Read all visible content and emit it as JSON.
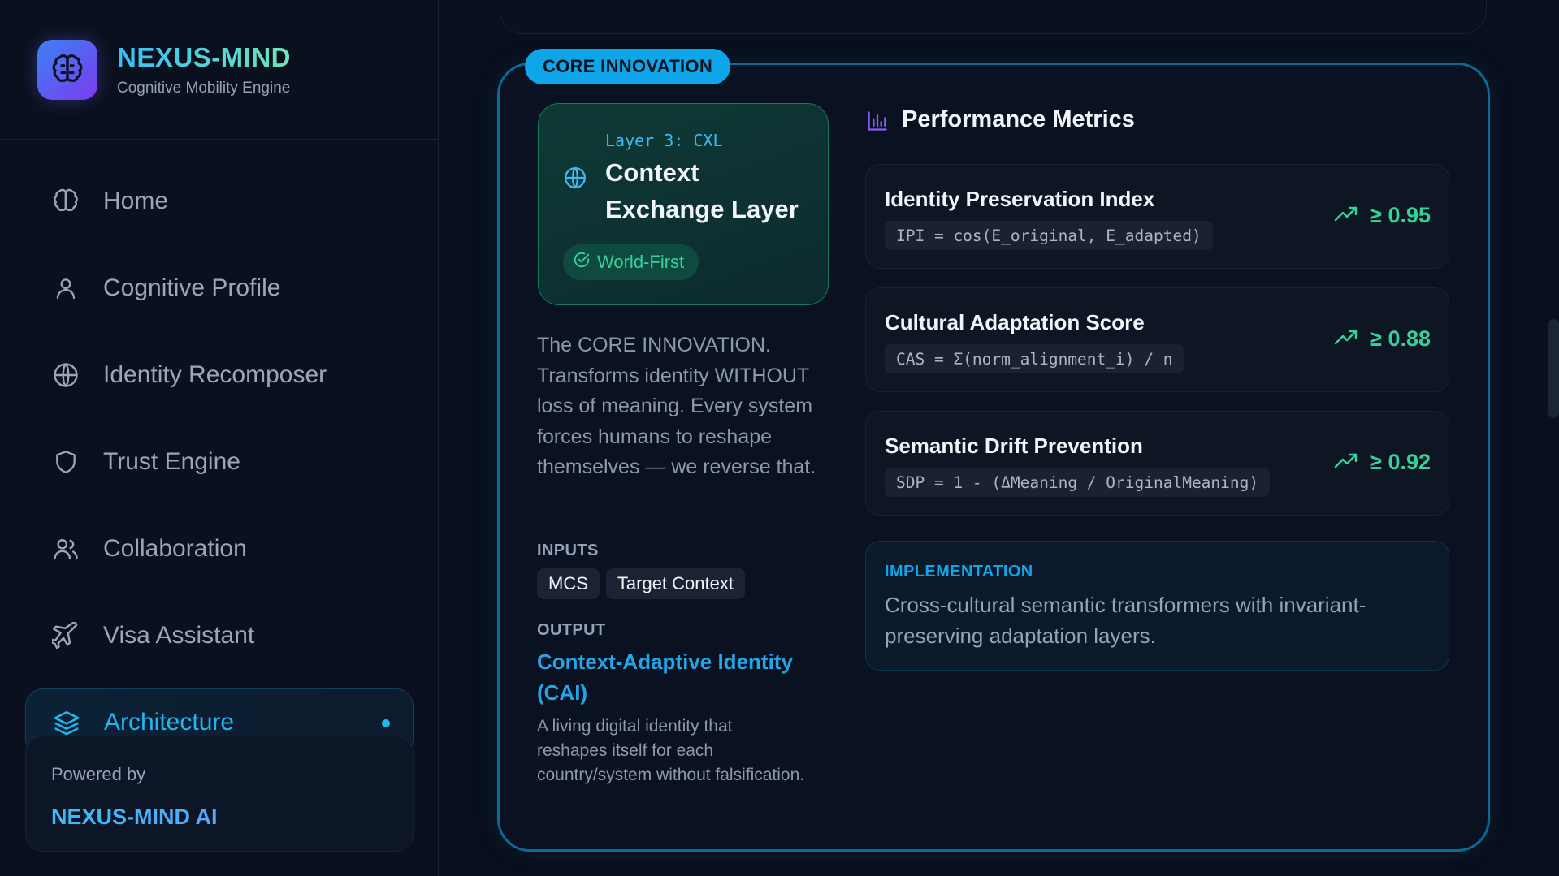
{
  "brand": {
    "title": "NEXUS-MIND",
    "subtitle": "Cognitive Mobility Engine",
    "icon": "brain-icon"
  },
  "nav": {
    "items": [
      {
        "label": "Home",
        "icon": "brain-icon"
      },
      {
        "label": "Cognitive Profile",
        "icon": "user-icon"
      },
      {
        "label": "Identity Recomposer",
        "icon": "globe-icon"
      },
      {
        "label": "Trust Engine",
        "icon": "shield-icon"
      },
      {
        "label": "Collaboration",
        "icon": "users-icon"
      },
      {
        "label": "Visa Assistant",
        "icon": "plane-icon"
      },
      {
        "label": "Architecture",
        "icon": "layers-icon",
        "active": true
      }
    ]
  },
  "powered": {
    "label": "Powered by",
    "name": "NEXUS-MIND AI"
  },
  "core": {
    "badge": "CORE INNOVATION",
    "layer_tag": "Layer 3: CXL",
    "layer_name": "Context Exchange Layer",
    "world_first": "World-First",
    "description": "The CORE INNOVATION. Transforms identity WITHOUT loss of meaning. Every system forces humans to reshape themselves — we reverse that.",
    "inputs_label": "INPUTS",
    "inputs": [
      "MCS",
      "Target Context"
    ],
    "output_label": "OUTPUT",
    "output_title": "Context-Adaptive Identity (CAI)",
    "output_desc": "A living digital identity that reshapes itself for each country/system without falsification."
  },
  "performance": {
    "title": "Performance Metrics",
    "metrics": [
      {
        "name": "Identity Preservation Index",
        "formula": "IPI = cos(E_original, E_adapted)",
        "value": "≥ 0.95"
      },
      {
        "name": "Cultural Adaptation Score",
        "formula": "CAS = Σ(norm_alignment_i) / n",
        "value": "≥ 0.88"
      },
      {
        "name": "Semantic Drift Prevention",
        "formula": "SDP = 1 - (ΔMeaning / OriginalMeaning)",
        "value": "≥ 0.92"
      }
    ]
  },
  "implementation": {
    "label": "IMPLEMENTATION",
    "text": "Cross-cultural semantic transformers with invariant-preserving adaptation layers."
  },
  "colors": {
    "accent": "#22b5ee",
    "success": "#34d399",
    "background": "#090f1c"
  }
}
